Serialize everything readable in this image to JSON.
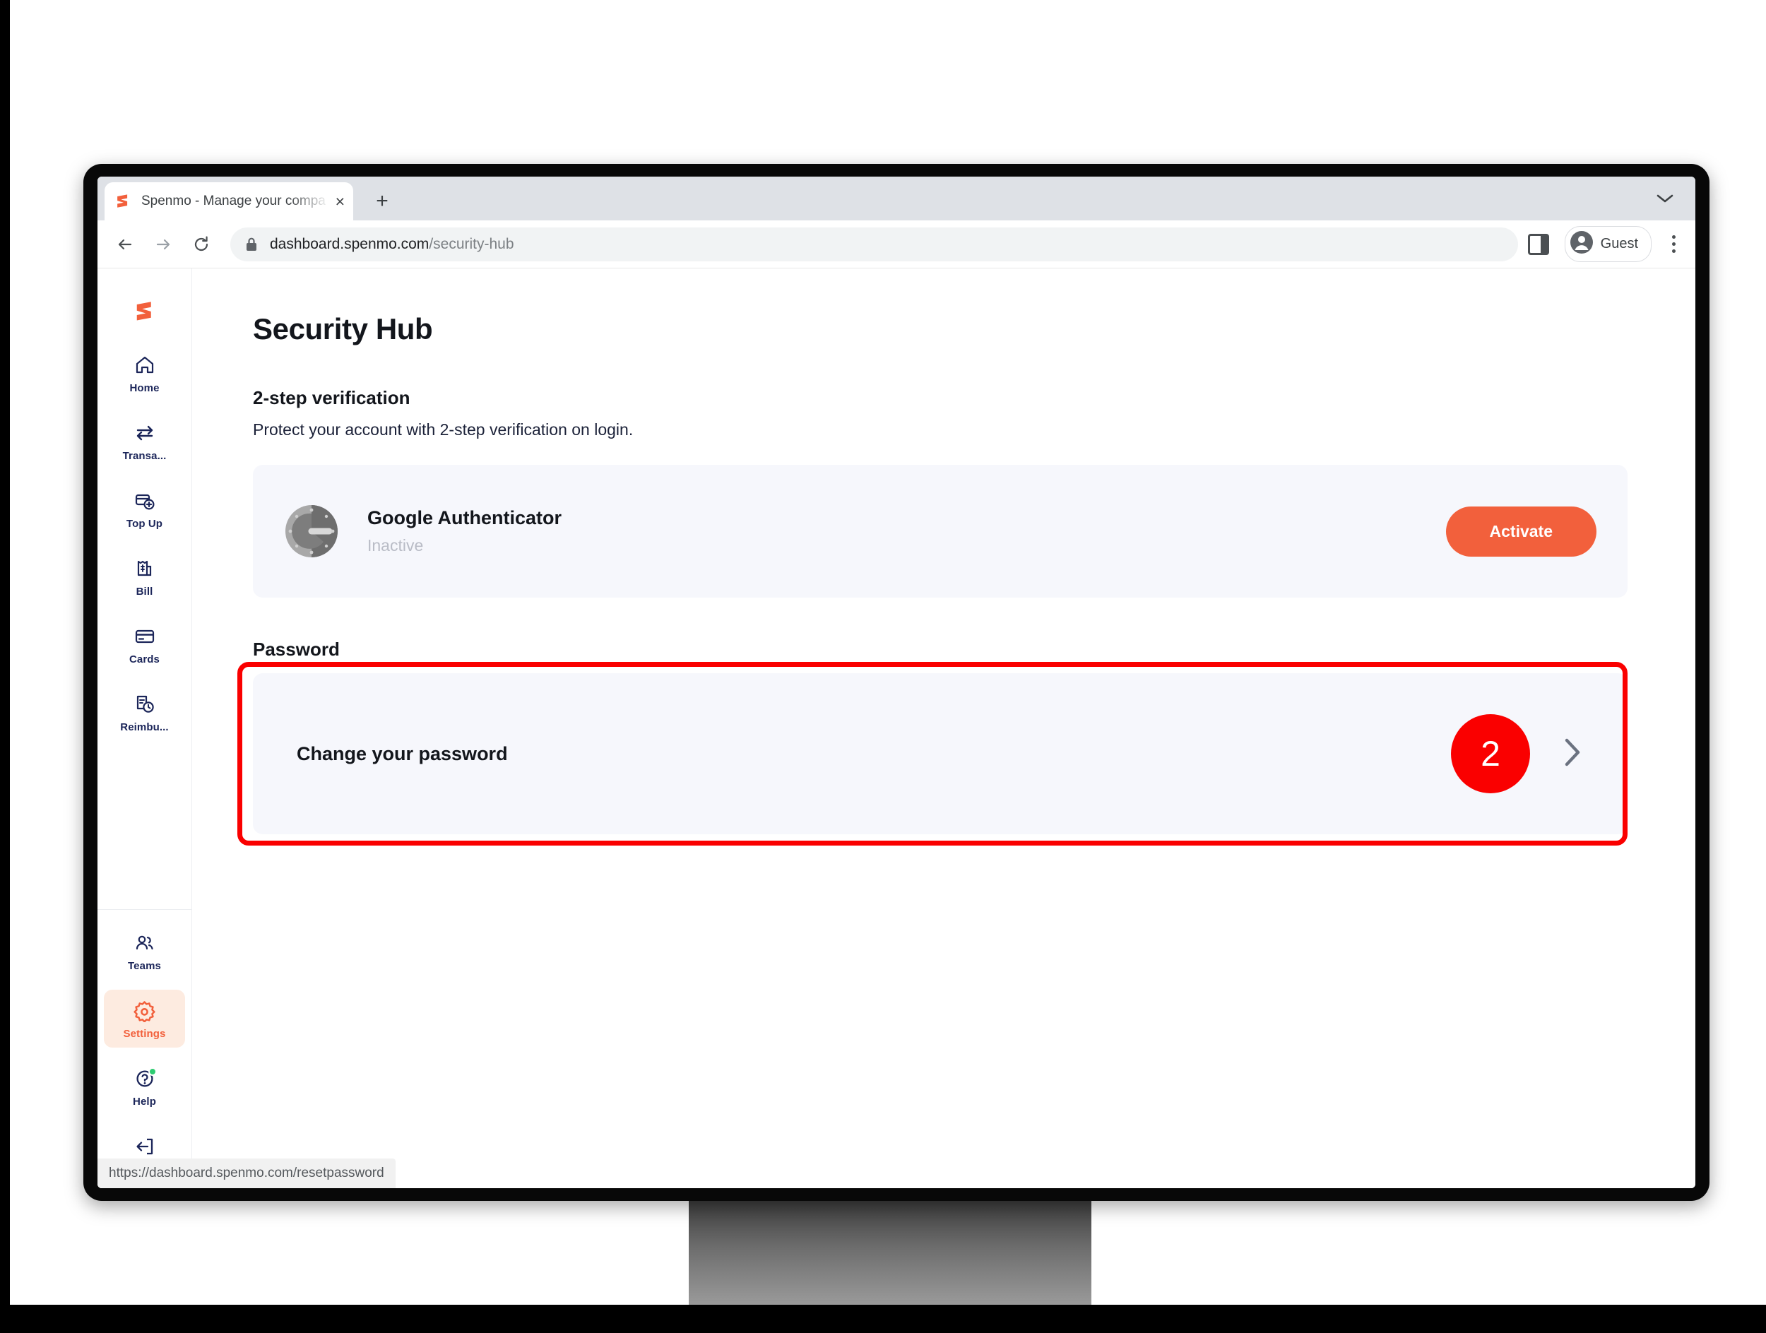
{
  "browser": {
    "tab": {
      "title": "Spenmo - Manage your compa",
      "favicon": "spenmo-logo-icon",
      "close": "×"
    },
    "new_tab_label": "+",
    "toolbar": {
      "back": "←",
      "forward": "→",
      "reload": "↻",
      "lock": "lock-icon",
      "url_domain": "dashboard.spenmo.com",
      "url_path": "/security-hub",
      "profile_label": "Guest"
    },
    "statusbar_url": "https://dashboard.spenmo.com/resetpassword"
  },
  "sidebar": {
    "logo": "spenmo-logo",
    "items": [
      {
        "label": "Home",
        "icon": "home-icon",
        "active": false
      },
      {
        "label": "Transa...",
        "icon": "transfer-icon",
        "active": false
      },
      {
        "label": "Top Up",
        "icon": "top-up-icon",
        "active": false
      },
      {
        "label": "Bill",
        "icon": "bill-icon",
        "active": false
      },
      {
        "label": "Cards",
        "icon": "card-icon",
        "active": false
      },
      {
        "label": "Reimbu...",
        "icon": "reimbursement-icon",
        "active": false
      }
    ],
    "bottom_items": [
      {
        "label": "Teams",
        "icon": "teams-icon",
        "active": false
      },
      {
        "label": "Settings",
        "icon": "gear-icon",
        "active": true
      },
      {
        "label": "Help",
        "icon": "help-icon",
        "active": false,
        "badge": true
      },
      {
        "label": "Logout",
        "icon": "logout-icon",
        "active": false
      }
    ]
  },
  "main": {
    "page_title": "Security Hub",
    "two_step": {
      "heading": "2-step verification",
      "description": "Protect your account with 2-step verification on login.",
      "provider_name": "Google Authenticator",
      "provider_icon": "google-authenticator-icon",
      "provider_status": "Inactive",
      "action_label": "Activate"
    },
    "password": {
      "heading": "Password",
      "row_label": "Change your password",
      "chevron": "chevron-right-icon"
    }
  },
  "annotation": {
    "step_number": "2",
    "accent_color": "#fa0000"
  },
  "colors": {
    "brand_orange": "#f2603c",
    "card_bg": "#f6f7fc",
    "text_dark": "#13161c",
    "help_badge_green": "#2ecc71"
  }
}
